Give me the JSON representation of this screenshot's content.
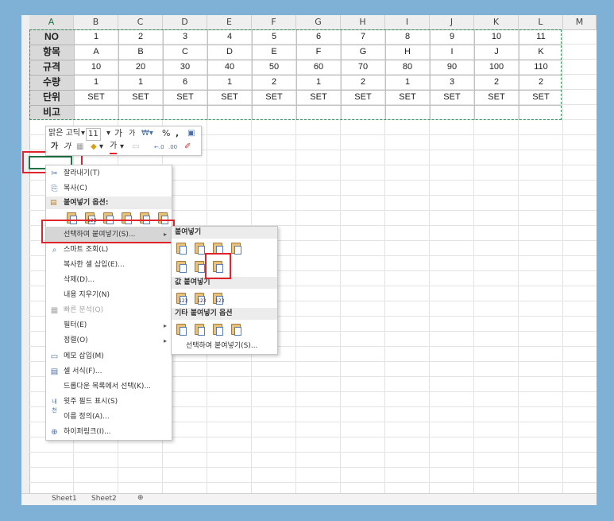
{
  "columns": [
    "A",
    "B",
    "C",
    "D",
    "E",
    "F",
    "G",
    "H",
    "I",
    "J",
    "K",
    "L",
    "M"
  ],
  "table": {
    "rows": [
      {
        "header": "NO",
        "values": [
          "1",
          "2",
          "3",
          "4",
          "5",
          "6",
          "7",
          "8",
          "9",
          "10",
          "11"
        ]
      },
      {
        "header": "항목",
        "values": [
          "A",
          "B",
          "C",
          "D",
          "E",
          "F",
          "G",
          "H",
          "I",
          "J",
          "K"
        ]
      },
      {
        "header": "규격",
        "values": [
          "10",
          "20",
          "30",
          "40",
          "50",
          "60",
          "70",
          "80",
          "90",
          "100",
          "110"
        ]
      },
      {
        "header": "수량",
        "values": [
          "1",
          "1",
          "6",
          "1",
          "2",
          "1",
          "2",
          "1",
          "3",
          "2",
          "2"
        ]
      },
      {
        "header": "단위",
        "values": [
          "SET",
          "SET",
          "SET",
          "SET",
          "SET",
          "SET",
          "SET",
          "SET",
          "SET",
          "SET",
          "SET"
        ]
      },
      {
        "header": "비고",
        "values": [
          "",
          "",
          "",
          "",
          "",
          "",
          "",
          "",
          "",
          "",
          ""
        ]
      }
    ]
  },
  "mini_toolbar": {
    "font_name": "맑은 고딕",
    "font_size": "11",
    "grow_font": "가",
    "shrink_font": "가",
    "percent": "%",
    "comma": ",",
    "bold": "가",
    "italic": "가",
    "font_color_letter": "가"
  },
  "context_menu": {
    "items": [
      {
        "label": "잘라내기(T)",
        "icon": "scissors-icon",
        "glyph": "✂"
      },
      {
        "label": "복사(C)",
        "icon": "copy-icon",
        "glyph": "⎘"
      },
      {
        "label": "붙여넣기 옵션:",
        "icon": "paste-icon",
        "section": true
      },
      {
        "label": "선택하여 붙여넣기(S)...",
        "icon": "none",
        "highlighted": true,
        "submenu": true
      },
      {
        "label": "스마트 조회(L)",
        "icon": "search-icon",
        "glyph": "⌕"
      },
      {
        "label": "복사한 셀 삽입(E)...",
        "icon": "none"
      },
      {
        "label": "삭제(D)...",
        "icon": "none"
      },
      {
        "label": "내용 지우기(N)",
        "icon": "none"
      },
      {
        "label": "빠른 분석(Q)",
        "icon": "quick-analysis-icon",
        "disabled": true,
        "glyph": "▦"
      },
      {
        "label": "필터(E)",
        "icon": "none",
        "submenu": true
      },
      {
        "label": "정렬(O)",
        "icon": "none",
        "submenu": true
      },
      {
        "label": "메모 삽입(M)",
        "icon": "comment-icon",
        "glyph": "▭"
      },
      {
        "label": "셀 서식(F)...",
        "icon": "format-cells-icon",
        "glyph": "▤"
      },
      {
        "label": "드롭다운 목록에서 선택(K)...",
        "icon": "none"
      },
      {
        "label": "윗주 필드 표시(S)",
        "icon": "phonetic-icon",
        "glyph": "ㅂ"
      },
      {
        "label": "이름 정의(A)...",
        "icon": "none"
      },
      {
        "label": "하이퍼링크(I)...",
        "icon": "hyperlink-icon",
        "glyph": "⊕"
      }
    ]
  },
  "submenu": {
    "paste_header": "붙여넣기",
    "values_header": "값 붙여넣기",
    "other_header": "기타 붙여넣기 옵션",
    "paste_special": "선택하여 붙여넣기(S)...",
    "values_badge": "123"
  },
  "sheet_tabs": [
    "Sheet1",
    "Sheet2"
  ]
}
